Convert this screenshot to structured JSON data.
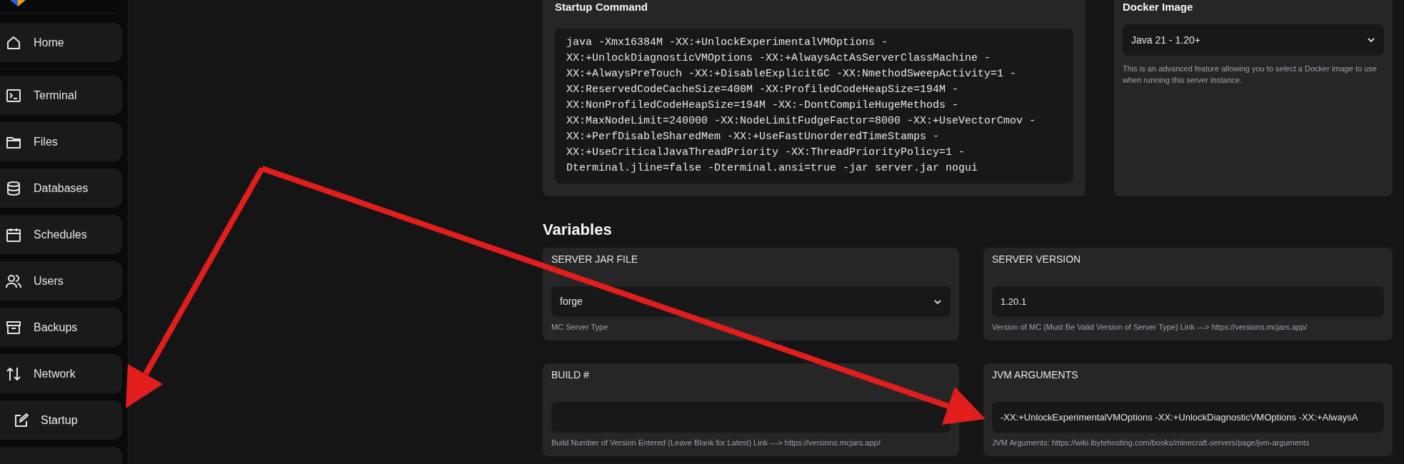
{
  "sidebar": {
    "items": [
      {
        "label": "Home",
        "selected": false
      },
      {
        "label": "Terminal",
        "selected": false
      },
      {
        "label": "Files",
        "selected": false
      },
      {
        "label": "Databases",
        "selected": false
      },
      {
        "label": "Schedules",
        "selected": false
      },
      {
        "label": "Users",
        "selected": false
      },
      {
        "label": "Backups",
        "selected": false
      },
      {
        "label": "Network",
        "selected": false
      },
      {
        "label": "Startup",
        "selected": true
      }
    ]
  },
  "startup_command": {
    "title": "Startup Command",
    "command": "java -Xmx16384M -XX:+UnlockExperimentalVMOptions -XX:+UnlockDiagnosticVMOptions -XX:+AlwaysActAsServerClassMachine -XX:+AlwaysPreTouch -XX:+DisableExplicitGC -XX:NmethodSweepActivity=1 -XX:ReservedCodeCacheSize=400M -XX:ProfiledCodeHeapSize=194M -XX:NonProfiledCodeHeapSize=194M -XX:-DontCompileHugeMethods -XX:MaxNodeLimit=240000 -XX:NodeLimitFudgeFactor=8000 -XX:+UseVectorCmov -XX:+PerfDisableSharedMem -XX:+UseFastUnorderedTimeStamps -XX:+UseCriticalJavaThreadPriority -XX:ThreadPriorityPolicy=1 -Dterminal.jline=false -Dterminal.ansi=true -jar server.jar nogui"
  },
  "docker_image": {
    "title": "Docker Image",
    "value": "Java 21 - 1.20+",
    "description": "This is an advanced feature allowing you to select a Docker image to use when running this server instance."
  },
  "variables": {
    "title": "Variables",
    "items": [
      {
        "name": "SERVER JAR FILE",
        "kind": "select",
        "value": "forge",
        "description": "MC Server Type"
      },
      {
        "name": "SERVER VERSION",
        "kind": "text",
        "value": "1.20.1",
        "description": "Version of MC (Must Be Valid Version of Server Type) Link ---> https://versions.mcjars.app/"
      },
      {
        "name": "BUILD #",
        "kind": "text",
        "description": "Build Number of Version Entered (Leave Blank for Latest) Link ---> https://versions.mcjars.app/"
      },
      {
        "name": "JVM ARGUMENTS",
        "kind": "text",
        "value": "-XX:+UnlockExperimentalVMOptions -XX:+UnlockDiagnosticVMOptions -XX:+AlwaysA",
        "description": "JVM Arguments: https://wiki.ibytehosting.com/books/minecraft-servers/page/jvm-arguments"
      }
    ]
  }
}
